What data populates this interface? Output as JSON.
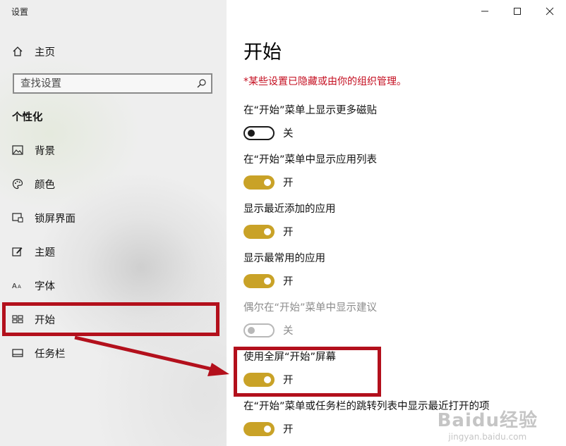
{
  "window": {
    "title": "设置"
  },
  "sidebar": {
    "home_label": "主页",
    "search": {
      "placeholder": "查找设置"
    },
    "section_title": "个性化",
    "items": [
      {
        "label": "背景",
        "icon": "picture-icon"
      },
      {
        "label": "颜色",
        "icon": "palette-icon"
      },
      {
        "label": "锁屏界面",
        "icon": "lock-screen-icon"
      },
      {
        "label": "主题",
        "icon": "theme-icon"
      },
      {
        "label": "字体",
        "icon": "font-icon"
      },
      {
        "label": "开始",
        "icon": "start-icon"
      },
      {
        "label": "任务栏",
        "icon": "taskbar-icon"
      }
    ]
  },
  "main": {
    "title": "开始",
    "notice": "*某些设置已隐藏或由你的组织管理。",
    "settings": [
      {
        "label": "在“开始”菜单上显示更多磁贴",
        "state": "关",
        "on": false,
        "disabled": false
      },
      {
        "label": "在“开始”菜单中显示应用列表",
        "state": "开",
        "on": true,
        "disabled": false
      },
      {
        "label": "显示最近添加的应用",
        "state": "开",
        "on": true,
        "disabled": false
      },
      {
        "label": "显示最常用的应用",
        "state": "开",
        "on": true,
        "disabled": false
      },
      {
        "label": "偶尔在“开始”菜单中显示建议",
        "state": "关",
        "on": false,
        "disabled": true
      },
      {
        "label": "使用全屏“开始”屏幕",
        "state": "开",
        "on": true,
        "disabled": false
      },
      {
        "label": "在“开始”菜单或任务栏的跳转列表中显示最近打开的项",
        "state": "开",
        "on": true,
        "disabled": false
      }
    ]
  },
  "watermark": {
    "main": "Baidu经验",
    "sub": "jingyan.baidu.com"
  },
  "colors": {
    "accent": "#c9a227",
    "annotation_red": "#b3101c",
    "notice_red": "#c40d1f"
  }
}
